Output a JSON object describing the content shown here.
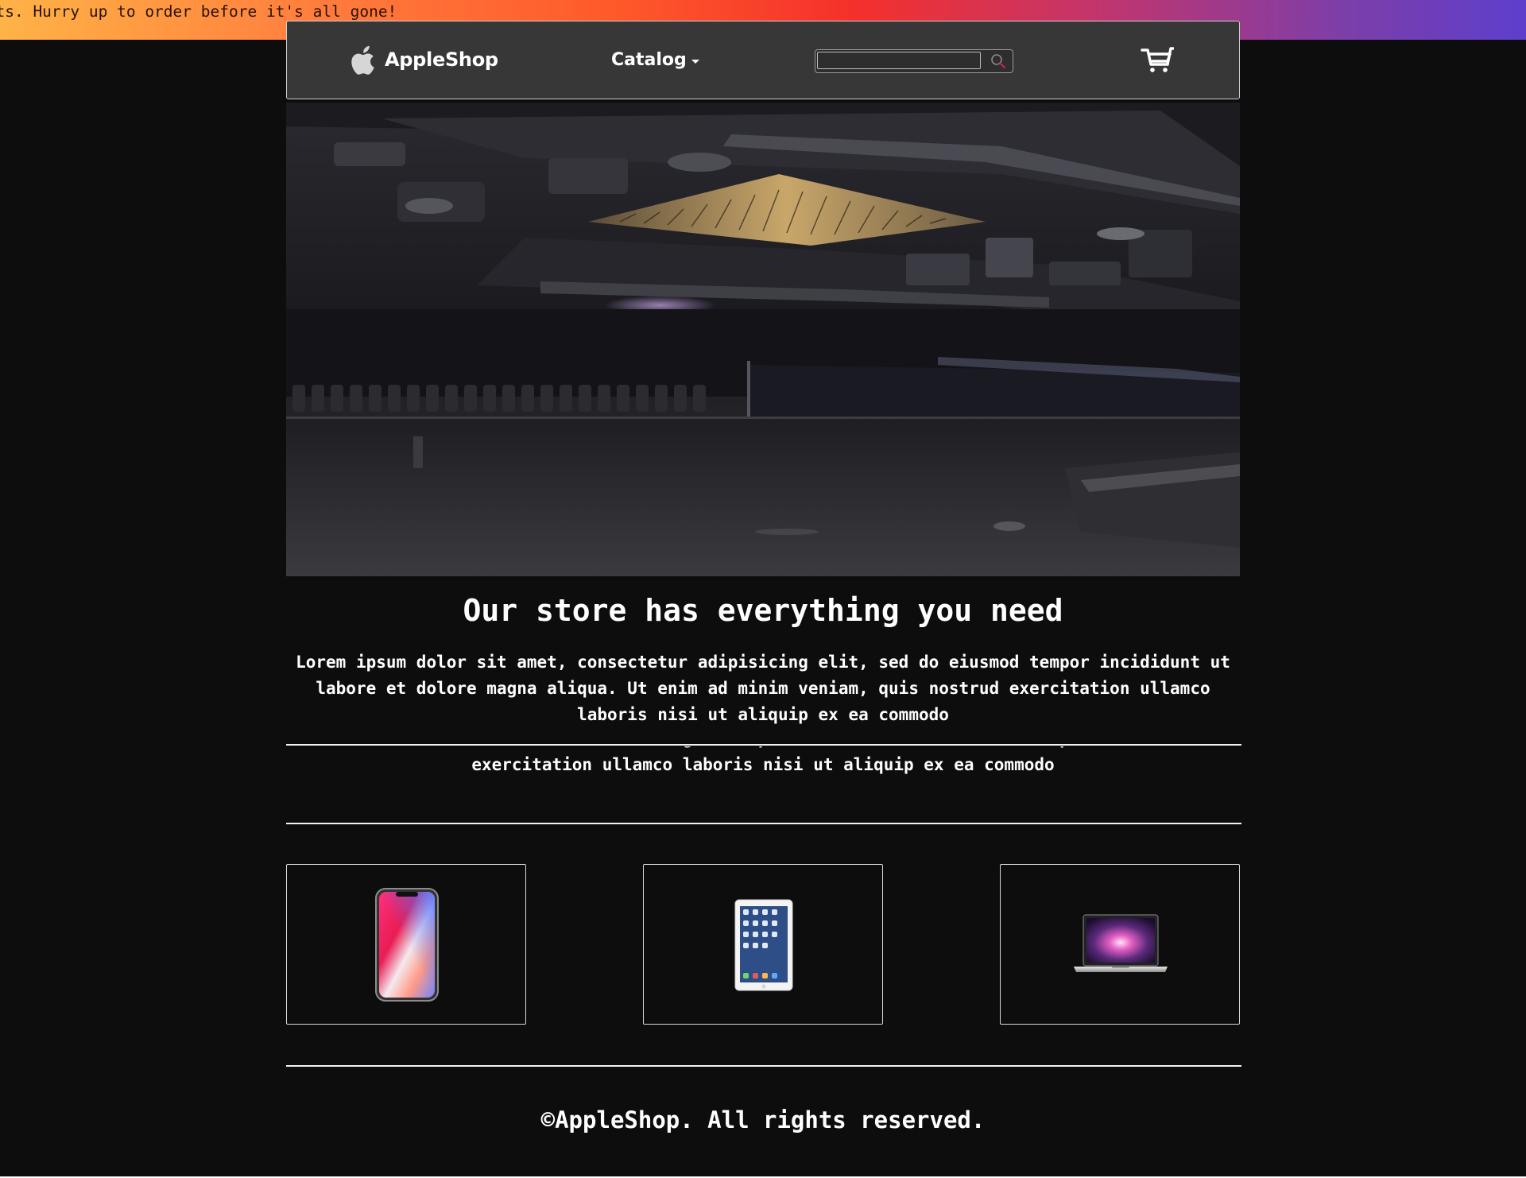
{
  "announcement": {
    "text": "ucts. Hurry up to order before it's all gone!"
  },
  "header": {
    "brand_name": "AppleShop",
    "catalog_label": "Catalog",
    "search_placeholder": ""
  },
  "hero": {
    "image": "macbook-internal-hardware-closeup"
  },
  "main": {
    "headline": "Our store has everything you need",
    "lead": "Lorem ipsum dolor sit amet, consectetur adipisicing elit, sed do eiusmod tempor incididunt ut labore et dolore magna aliqua. Ut enim ad minim veniam, quis nostrud exercitation ullamco laboris nisi ut aliquip ex ea commodo",
    "strip_text": "incididunt ut labore et dolore magna aliqua. Ut enim ad minim veniam, quis nostrud exercitation ullamco laboris nisi ut aliquip ex ea commodo"
  },
  "products": [
    {
      "image": "iphone-icon"
    },
    {
      "image": "ipad-icon"
    },
    {
      "image": "macbook-icon"
    }
  ],
  "footer": {
    "copyright": "©AppleShop. All rights reserved."
  },
  "colors": {
    "background": "#0d0d0d",
    "header_bg": "#373737",
    "text": "#ffffff",
    "banner_gradient_start": "#ffb347",
    "banner_gradient_end": "#5d3fcc"
  }
}
